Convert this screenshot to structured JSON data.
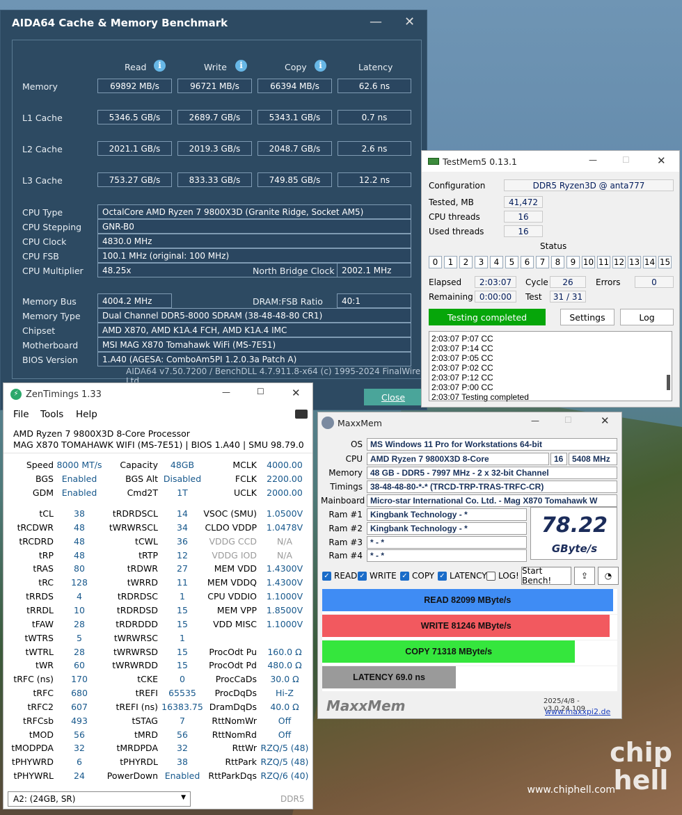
{
  "background": {
    "watermark": "chip hell",
    "site": "www.chiphell.com"
  },
  "aida": {
    "title": "AIDA64 Cache & Memory Benchmark",
    "cols": [
      "Read",
      "Write",
      "Copy",
      "Latency"
    ],
    "rows": [
      {
        "label": "Memory",
        "vals": [
          "69892 MB/s",
          "96721 MB/s",
          "66394 MB/s",
          "62.6 ns"
        ]
      },
      {
        "label": "L1 Cache",
        "vals": [
          "5346.5 GB/s",
          "2689.7 GB/s",
          "5343.1 GB/s",
          "0.7 ns"
        ]
      },
      {
        "label": "L2 Cache",
        "vals": [
          "2021.1 GB/s",
          "2019.3 GB/s",
          "2048.7 GB/s",
          "2.6 ns"
        ]
      },
      {
        "label": "L3 Cache",
        "vals": [
          "753.27 GB/s",
          "833.33 GB/s",
          "749.85 GB/s",
          "12.2 ns"
        ]
      }
    ],
    "cpu_type_label": "CPU Type",
    "cpu_type": "OctalCore AMD Ryzen 7 9800X3D  (Granite Ridge, Socket AM5)",
    "cpu_stepping_label": "CPU Stepping",
    "cpu_stepping": "GNR-B0",
    "cpu_clock_label": "CPU Clock",
    "cpu_clock": "4830.0 MHz",
    "cpu_fsb_label": "CPU FSB",
    "cpu_fsb": "100.1 MHz  (original: 100 MHz)",
    "cpu_mult_label": "CPU Multiplier",
    "cpu_mult": "48.25x",
    "nb_clock_label": "North Bridge Clock",
    "nb_clock": "2002.1 MHz",
    "mem_bus_label": "Memory Bus",
    "mem_bus": "4004.2 MHz",
    "dram_fsb_label": "DRAM:FSB Ratio",
    "dram_fsb": "40:1",
    "mem_type_label": "Memory Type",
    "mem_type": "Dual Channel DDR5-8000 SDRAM  (38-48-48-80 CR1)",
    "chipset_label": "Chipset",
    "chipset": "AMD X870, AMD K1A.4 FCH, AMD K1A.4 IMC",
    "mobo_label": "Motherboard",
    "mobo": "MSI MAG X870 Tomahawk WiFi (MS-7E51)",
    "bios_label": "BIOS Version",
    "bios": "1.A40  (AGESA: ComboAm5PI 1.2.0.3a Patch A)",
    "footer": "AIDA64 v7.50.7200 / BenchDLL 4.7.911.8-x64  (c) 1995-2024 FinalWire Ltd.",
    "close": "Close"
  },
  "testmem": {
    "title": "TestMem5  0.13.1",
    "config_label": "Configuration",
    "config": "DDR5 Ryzen3D @ anta777",
    "tested_label": "Tested, MB",
    "tested": "41,472",
    "cpu_threads_label": "CPU threads",
    "cpu_threads": "16",
    "used_threads_label": "Used threads",
    "used_threads": "16",
    "status_label": "Status",
    "status_nums": [
      "0",
      "1",
      "2",
      "3",
      "4",
      "5",
      "6",
      "7",
      "8",
      "9",
      "10",
      "11",
      "12",
      "13",
      "14",
      "15"
    ],
    "elapsed_label": "Elapsed",
    "elapsed": "2:03:07",
    "cycle_label": "Cycle",
    "cycle": "26",
    "errors_label": "Errors",
    "errors": "0",
    "remaining_label": "Remaining",
    "remaining": "0:00:00",
    "test_label": "Test",
    "test": "31 / 31",
    "status_btn": "Testing completed",
    "settings_btn": "Settings",
    "log_btn": "Log",
    "log": [
      "2:03:07  P:07 CC",
      "2:03:07  P:14 CC",
      "2:03:07  P:05 CC",
      "2:03:07  P:02 CC",
      "2:03:07  P:12 CC",
      "2:03:07  P:00 CC",
      "2:03:07  Testing completed"
    ]
  },
  "zen": {
    "title": "ZenTimings 1.33",
    "menu": [
      "File",
      "Tools",
      "Help"
    ],
    "cpu": "AMD Ryzen 7 9800X3D 8-Core Processor",
    "board": "MAG X870 TOMAHAWK WIFI (MS-7E51) | BIOS 1.A40 | SMU 98.79.0",
    "top": [
      [
        "Speed",
        "8000 MT/s",
        "Capacity",
        "48GB",
        "MCLK",
        "4000.00"
      ],
      [
        "BGS",
        "Enabled",
        "BGS Alt",
        "Disabled",
        "FCLK",
        "2200.00"
      ],
      [
        "GDM",
        "Enabled",
        "Cmd2T",
        "1T",
        "UCLK",
        "2000.00"
      ]
    ],
    "rows": [
      [
        "tCL",
        "38",
        "tRDRDSCL",
        "14",
        "VSOC (SMU)",
        "1.0500V"
      ],
      [
        "tRCDWR",
        "48",
        "tWRWRSCL",
        "34",
        "CLDO VDDP",
        "1.0478V"
      ],
      [
        "tRCDRD",
        "48",
        "tCWL",
        "36",
        "VDDG CCD",
        "N/A"
      ],
      [
        "tRP",
        "48",
        "tRTP",
        "12",
        "VDDG IOD",
        "N/A"
      ],
      [
        "tRAS",
        "80",
        "tRDWR",
        "27",
        "MEM VDD",
        "1.4300V"
      ],
      [
        "tRC",
        "128",
        "tWRRD",
        "11",
        "MEM VDDQ",
        "1.4300V"
      ],
      [
        "tRRDS",
        "4",
        "tRDRDSC",
        "1",
        "CPU VDDIO",
        "1.1000V"
      ],
      [
        "tRRDL",
        "10",
        "tRDRDSD",
        "15",
        "MEM VPP",
        "1.8500V"
      ],
      [
        "tFAW",
        "28",
        "tRDRDDD",
        "15",
        "VDD MISC",
        "1.1000V"
      ],
      [
        "tWTRS",
        "5",
        "tWRWRSC",
        "1",
        "",
        ""
      ],
      [
        "tWTRL",
        "28",
        "tWRWRSD",
        "15",
        "ProcOdt Pu",
        "160.0 Ω"
      ],
      [
        "tWR",
        "60",
        "tWRWRDD",
        "15",
        "ProcOdt Pd",
        "480.0 Ω"
      ],
      [
        "tRFC (ns)",
        "170",
        "tCKE",
        "0",
        "ProcCaDs",
        "30.0 Ω"
      ],
      [
        "tRFC",
        "680",
        "tREFI",
        "65535",
        "ProcDqDs",
        "Hi-Z"
      ],
      [
        "tRFC2",
        "607",
        "tREFI (ns)",
        "16383.75",
        "DramDqDs",
        "40.0 Ω"
      ],
      [
        "tRFCsb",
        "493",
        "tSTAG",
        "7",
        "RttNomWr",
        "Off"
      ],
      [
        "tMOD",
        "56",
        "tMRD",
        "56",
        "RttNomRd",
        "Off"
      ],
      [
        "tMODPDA",
        "32",
        "tMRDPDA",
        "32",
        "RttWr",
        "RZQ/5 (48)"
      ],
      [
        "tPHYWRD",
        "6",
        "tPHYRDL",
        "38",
        "RttPark",
        "RZQ/5 (48)"
      ],
      [
        "tPHYWRL",
        "24",
        "PowerDown",
        "Enabled",
        "RttParkDqs",
        "RZQ/6 (40)"
      ]
    ],
    "select": "A2: (24GB, SR)",
    "ddr": "DDR5"
  },
  "maxx": {
    "title": "MaxxMem",
    "os_label": "OS",
    "os": "MS Windows 11 Pro for Workstations 64-bit",
    "cpu_label": "CPU",
    "cpu": "AMD Ryzen 7 9800X3D 8-Core",
    "cpu_threads": "16",
    "cpu_clock": "5408 MHz",
    "mem_label": "Memory",
    "mem": "48 GB - DDR5 - 7997 MHz - 2 x 32-bit Channel",
    "tim_label": "Timings",
    "tim": "38-48-48-80-*-* (TRCD-TRP-TRAS-TRFC-CR)",
    "mb_label": "Mainboard",
    "mb": "Micro-star International Co. Ltd. - Mag X870 Tomahawk W",
    "ram1_label": "Ram #1",
    "ram1": "Kingbank Technology - *",
    "ram2_label": "Ram #2",
    "ram2": "Kingbank Technology - *",
    "ram3_label": "Ram #3",
    "ram3": "* - *",
    "ram4_label": "Ram #4",
    "ram4": "* - *",
    "score": "78.22",
    "unit": "GByte/s",
    "cb_read": "READ",
    "cb_write": "WRITE",
    "cb_copy": "COPY",
    "cb_latency": "LATENCY",
    "cb_log": "LOG!",
    "start": "Start Bench!",
    "read_txt": "READ  82099  MByte/s",
    "read_frac": 1.0,
    "read_color": "#3f8cf4",
    "write_txt": "WRITE  81246  MByte/s",
    "write_frac": 0.99,
    "write_color": "#f2595f",
    "copy_txt": "COPY  71318  MByte/s",
    "copy_frac": 0.87,
    "copy_color": "#35e63d",
    "lat_txt": "LATENCY  69.0  ns",
    "lat_frac": 0.46,
    "lat_color": "#9a9a9a",
    "logo": "MaxxMem",
    "version": "2025/4/8 - v3.0.24.109",
    "url": "www.maxxpi2.de"
  }
}
